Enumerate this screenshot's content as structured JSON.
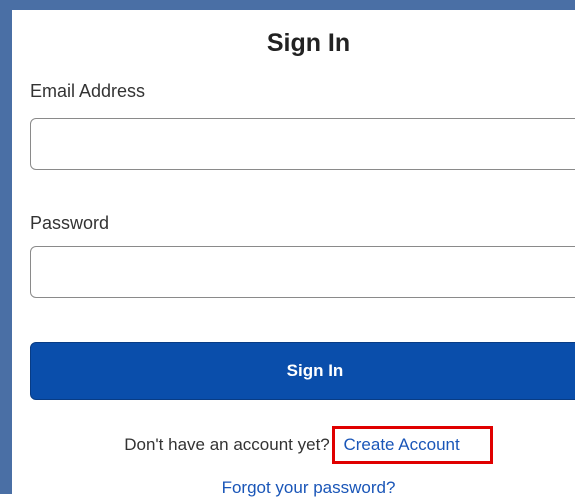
{
  "form": {
    "title": "Sign In",
    "email_label": "Email Address",
    "email_value": "",
    "password_label": "Password",
    "password_value": "",
    "signin_button": "Sign In",
    "no_account_text": "Don't have an account yet?",
    "create_account_link": "Create Account",
    "forgot_password_link": "Forgot your password?"
  },
  "colors": {
    "frame_border": "#4a6fa5",
    "button_bg": "#0a4eab",
    "link": "#1a56b8",
    "highlight_box": "#e00000"
  }
}
